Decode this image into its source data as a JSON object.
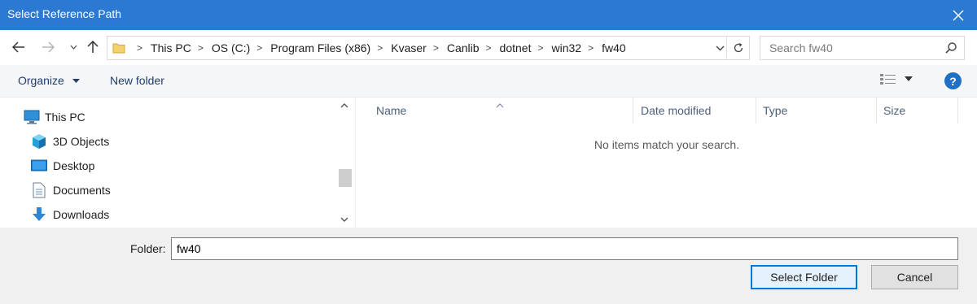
{
  "window": {
    "title": "Select Reference Path"
  },
  "nav": {
    "back_icon": "arrow-left-icon",
    "forward_icon": "arrow-right-icon",
    "recent_icon": "chevron-down-icon",
    "up_icon": "arrow-up-icon"
  },
  "address": {
    "breadcrumbs": [
      "This PC",
      "OS (C:)",
      "Program Files (x86)",
      "Kvaser",
      "Canlib",
      "dotnet",
      "win32",
      "fw40"
    ]
  },
  "search": {
    "placeholder": "Search fw40"
  },
  "toolbar": {
    "organize_label": "Organize",
    "new_folder_label": "New folder"
  },
  "navpane": {
    "items": [
      {
        "label": "This PC",
        "icon": "computer-icon"
      },
      {
        "label": "3D Objects",
        "icon": "cube-icon"
      },
      {
        "label": "Desktop",
        "icon": "desktop-icon"
      },
      {
        "label": "Documents",
        "icon": "document-icon"
      },
      {
        "label": "Downloads",
        "icon": "download-icon"
      }
    ]
  },
  "columns": [
    "Name",
    "Date modified",
    "Type",
    "Size"
  ],
  "content": {
    "empty_message": "No items match your search."
  },
  "footer": {
    "folder_label": "Folder:",
    "folder_value": "fw40",
    "select_label": "Select Folder",
    "cancel_label": "Cancel"
  },
  "colors": {
    "titlebar": "#2b79d0",
    "accent": "#0078d7"
  }
}
